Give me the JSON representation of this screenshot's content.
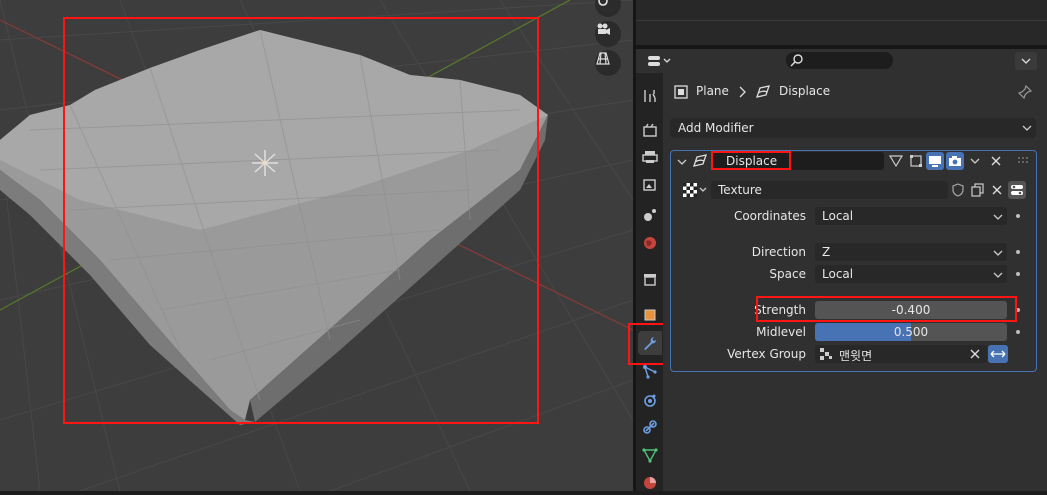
{
  "breadcrumb": {
    "object": "Plane",
    "modifier": "Displace"
  },
  "add_modifier": {
    "label": "Add Modifier"
  },
  "modifier": {
    "name": "Displace",
    "texture_label": "Texture",
    "coordinates": {
      "label": "Coordinates",
      "value": "Local"
    },
    "direction": {
      "label": "Direction",
      "value": "Z"
    },
    "space": {
      "label": "Space",
      "value": "Local"
    },
    "strength": {
      "label": "Strength",
      "value": "-0.400"
    },
    "midlevel": {
      "label": "Midlevel",
      "value": "0.500",
      "fraction": 0.5
    },
    "vertex_group": {
      "label": "Vertex Group",
      "value": "맨윗면"
    }
  },
  "colors": {
    "accent": "#4772b3",
    "highlight": "#ff1414",
    "panel": "#303030"
  },
  "icons": [
    "hand-icon",
    "camera-icon",
    "grid-icon",
    "wrench-icon"
  ]
}
